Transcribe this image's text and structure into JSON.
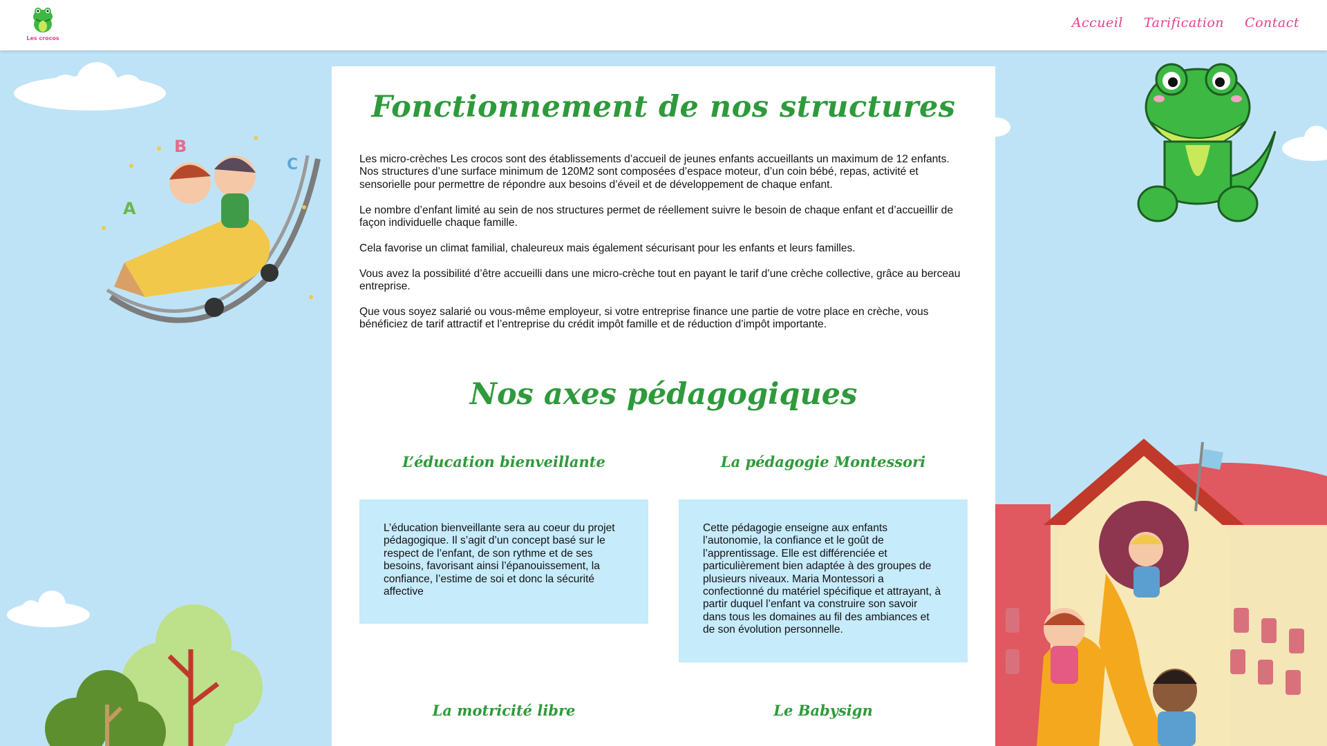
{
  "header": {
    "logo_text": "Les crocos",
    "nav": [
      "Accueil",
      "Tarification",
      "Contact"
    ]
  },
  "main": {
    "title": "Fonctionnement de nos structures",
    "intro_paragraphs": [
      "Les micro-crèches Les crocos sont des établissements d’accueil de jeunes enfants accueillants un maximum de 12 enfants. Nos structures d’une surface minimum de 120M2 sont composées d’espace moteur, d’un coin bébé, repas, activité et sensorielle pour permettre de répondre aux besoins d’éveil et de développement de chaque enfant.",
      "Le nombre d’enfant limité au sein de nos structures permet de réellement suivre le besoin de chaque enfant et d’accueillir de façon individuelle chaque famille.",
      "Cela favorise un climat familial, chaleureux mais également sécurisant pour les enfants et leurs familles.",
      "Vous avez la possibilité d’être accueilli dans une micro-crèche tout en payant le tarif d’une crèche collective, grâce au berceau entreprise.",
      "Que vous soyez salarié ou vous-même employeur, si votre entreprise finance une partie de votre place en crèche, vous bénéficiez de tarif attractif et l’entreprise du crédit impôt famille et de réduction d’impôt importante."
    ],
    "axes_title": "Nos axes pédagogiques",
    "axes": [
      {
        "title": "L’éducation bienveillante",
        "text": "L’éducation bienveillante sera au coeur du projet pédagogique. Il s’agit d’un concept basé sur le respect de l’enfant, de son rythme et de ses besoins, favorisant ainsi l’épanouissement, la confiance, l’estime de soi et donc la sécurité affective"
      },
      {
        "title": "La pédagogie Montessori",
        "text": "Cette pédagogie enseigne aux enfants l’autonomie, la confiance et le goût de l’apprentissage. Elle est différenciée et particulièrement bien adaptée à des groupes de plusieurs niveaux. Maria Montessori a confectionné du matériel spécifique et attrayant, à partir duquel l’enfant va construire son savoir dans tous les domaines au fil des ambiances et de son évolution personnelle."
      },
      {
        "title": "La motricité libre"
      },
      {
        "title": "Le Babysign"
      }
    ]
  },
  "decor": {
    "letters": [
      "A",
      "B",
      "C"
    ]
  },
  "colors": {
    "background": "#bfe3f6",
    "accent_green": "#2e9a3b",
    "nav_pink": "#e83e8c",
    "box_blue": "#c6ebfb"
  }
}
